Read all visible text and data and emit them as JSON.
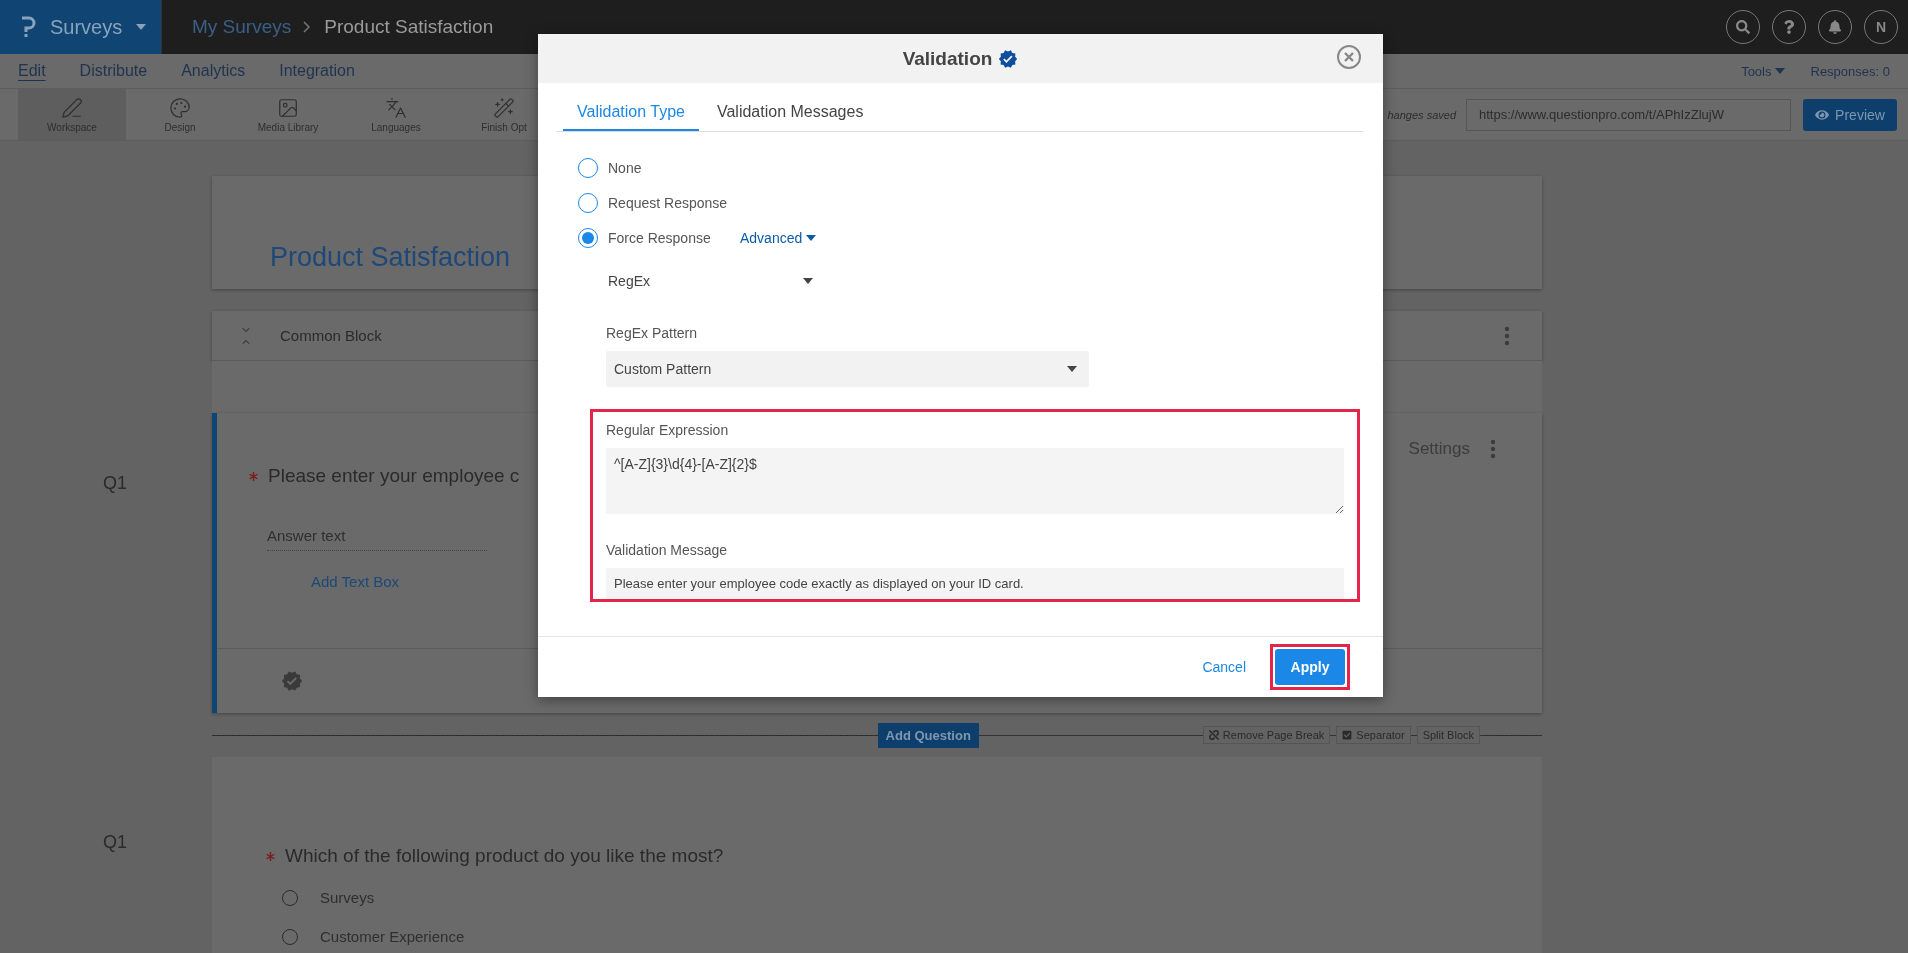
{
  "top_bar": {
    "app_menu": "Surveys",
    "breadcrumb": [
      "My Surveys",
      "Product Satisfaction"
    ],
    "avatar": "N"
  },
  "menu_bar": {
    "items": [
      {
        "label": "Edit",
        "selected": true
      },
      {
        "label": "Distribute",
        "selected": false
      },
      {
        "label": "Analytics",
        "selected": false
      },
      {
        "label": "Integration",
        "selected": false
      }
    ],
    "tools": "Tools",
    "responses": "Responses: 0"
  },
  "toolbar": {
    "items": [
      {
        "label": "Workspace",
        "selected": true,
        "kind": "pen"
      },
      {
        "label": "Design",
        "selected": false,
        "kind": "palette"
      },
      {
        "label": "Media Library",
        "selected": false,
        "kind": "image"
      },
      {
        "label": "Languages",
        "selected": false,
        "kind": "languages"
      },
      {
        "label": "Finish Opt",
        "selected": false,
        "kind": "wand"
      }
    ],
    "save_status": "hanges saved",
    "survey_url": "https://www.questionpro.com/t/APhIzZlujW",
    "preview": "Preview"
  },
  "survey": {
    "title": "Product Satisfaction",
    "block_name": "Common Block",
    "question_1": {
      "number": "Q1",
      "required": true,
      "text": "Please enter your employee c",
      "answer_placeholder": "Answer text",
      "add_link": "Add Text Box",
      "settings": "Settings"
    },
    "block_actions": {
      "add_question": "Add Question",
      "tags": [
        {
          "label": "Remove Page Break",
          "kind": "unlink"
        },
        {
          "label": "Separator",
          "kind": "check"
        },
        {
          "label": "Split Block",
          "kind": "plain"
        }
      ]
    },
    "question_2": {
      "number": "Q1",
      "required": true,
      "text": "Which of the following product do you like the most?",
      "options": [
        {
          "label": "Surveys",
          "selected": false
        },
        {
          "label": "Customer Experience",
          "selected": false
        }
      ]
    }
  },
  "modal": {
    "title": "Validation",
    "tabs": [
      {
        "label": "Validation Type",
        "selected": true
      },
      {
        "label": "Validation Messages",
        "selected": false
      }
    ],
    "options": [
      {
        "label": "None",
        "selected": false
      },
      {
        "label": "Request Response",
        "selected": false
      },
      {
        "label": "Force Response",
        "selected": true
      }
    ],
    "advanced": "Advanced",
    "validation_kind": "RegEx",
    "pattern_label": "RegEx Pattern",
    "pattern_value": "Custom Pattern",
    "regex_section": {
      "highlighted": true,
      "regex_label": "Regular Expression",
      "regex_value": "^[A-Z]{3}\\d{4}-[A-Z]{2}$",
      "message_label": "Validation Message",
      "message_value": "Please enter your employee code exactly as displayed on your ID card."
    },
    "cancel": "Cancel",
    "apply": {
      "label": "Apply",
      "highlighted": true
    }
  }
}
